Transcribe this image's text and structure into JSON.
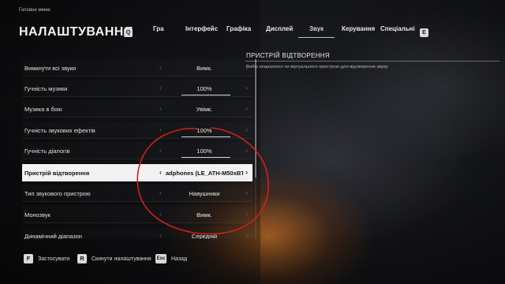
{
  "breadcrumb": "Головне меню",
  "title": "НАЛАШТУВАННЯ",
  "keys": {
    "prev_tab": "Q",
    "next_tab": "E"
  },
  "tabs": [
    {
      "label": "Гра",
      "active": false
    },
    {
      "label": "Інтерфейс",
      "active": false
    },
    {
      "label": "Графіка",
      "active": false
    },
    {
      "label": "Дисплей",
      "active": false
    },
    {
      "label": "Звук",
      "active": true
    },
    {
      "label": "Керування",
      "active": false
    },
    {
      "label": "Спеціальні",
      "active": false
    }
  ],
  "settings": [
    {
      "label": "Вимкнути всі звуки",
      "value": "Вимк.",
      "progress": null,
      "selected": false
    },
    {
      "label": "Гучність музики",
      "value": "100%",
      "progress": 1.0,
      "selected": false
    },
    {
      "label": "Музика в бою",
      "value": "Увімк.",
      "progress": null,
      "selected": false
    },
    {
      "label": "Гучність звукових ефектів",
      "value": "100%",
      "progress": 1.0,
      "selected": false
    },
    {
      "label": "Гучність діалогів",
      "value": "100%",
      "progress": 1.0,
      "selected": false
    },
    {
      "label": "Пристрій відтворення",
      "value": "adphones (LE_ATH-M50xBT)",
      "progress": null,
      "selected": true
    },
    {
      "label": "Тип звукового пристрою",
      "value": "Навушники",
      "progress": null,
      "selected": false
    },
    {
      "label": "Монозвук",
      "value": "Вимк.",
      "progress": null,
      "selected": false
    },
    {
      "label": "Динамічний діапазон",
      "value": "Середній",
      "progress": null,
      "selected": false
    }
  ],
  "arrows": {
    "left": "‹",
    "right": "›"
  },
  "panel": {
    "title": "ПРИСТРІЙ ВІДТВОРЕННЯ",
    "description": "Вибір апаратного чи віртуального пристрою для відтворення звуку."
  },
  "footer": [
    {
      "key": "F",
      "label": "Застосувати"
    },
    {
      "key": "R",
      "label": "Скинути налаштування"
    },
    {
      "key": "Esc",
      "label": "Назад"
    }
  ],
  "colors": {
    "annotation": "#d0201c",
    "selected_row_bg": "#f2f2f2"
  }
}
